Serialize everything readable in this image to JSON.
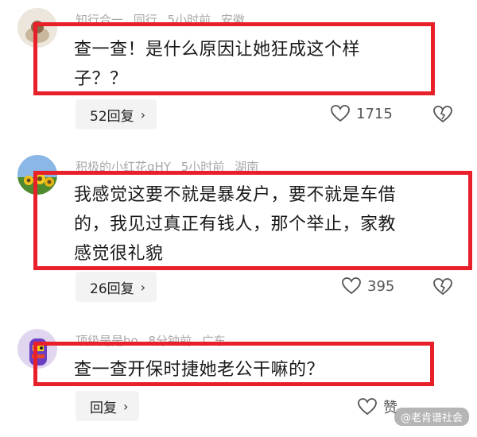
{
  "comments": [
    {
      "user": "知行合一",
      "tag": "同行",
      "time": "5小时前",
      "location": "安徽",
      "text_lines": [
        "查一查！是什么原因让她狂成这个样",
        "子？？"
      ],
      "reply_label": "52回复",
      "like_count": "1715"
    },
    {
      "user": "积极的小红花gHY",
      "time": "5小时前",
      "location": "湖南",
      "text_lines": [
        "我感觉这要不就是暴发户，要不就是车借",
        "的，我见过真正有钱人，那个举止，家教",
        "感觉很礼貌"
      ],
      "reply_label": "26回复",
      "like_count": "395"
    },
    {
      "user": "顶级是是ho",
      "time": "8分钟前",
      "location": "广东",
      "text_lines": [
        "查一查开保时捷她老公干嘛的？"
      ],
      "reply_label": "回复",
      "like_count": "赞"
    }
  ],
  "watermark": "@老肯谱社会",
  "icons": {
    "like": "heart-icon",
    "dislike": "broken-heart-icon",
    "chevron": "chevron-right-icon"
  },
  "colors": {
    "highlight": "#e8202a"
  }
}
